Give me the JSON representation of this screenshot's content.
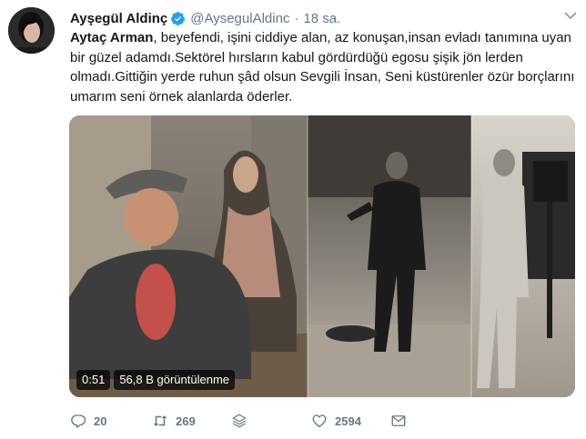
{
  "tweet": {
    "author_name": "Ayşegül Aldinç",
    "handle": "@AysegulAldinc",
    "separator": "·",
    "timestamp": "18 sa.",
    "mention": "Aytaç Arman",
    "text_after_mention": ", beyefendi, işini ciddiye alan, az konuşan,insan evladı tanımına uyan bir güzel adamdı.Sektörel hırsların kabul gördürdüğü egosu şişik jön lerden olmadı.Gittiğin yerde ruhun şâd olsun Sevgili İnsan, Seni küstürenler özür borçlarını umarım seni örnek alanlarda öderler."
  },
  "media": {
    "duration": "0:51",
    "views": "56,8 B görüntülenme"
  },
  "actions": {
    "reply_count": "20",
    "retweet_count": "269",
    "like_count": "2594"
  },
  "colors": {
    "text": "#14171a",
    "secondary": "#657786",
    "verified": "#1da1f2"
  },
  "icons": [
    "verified-badge-icon",
    "chevron-down-icon",
    "reply-icon",
    "retweet-icon",
    "stack-icon",
    "heart-icon",
    "mail-icon"
  ]
}
